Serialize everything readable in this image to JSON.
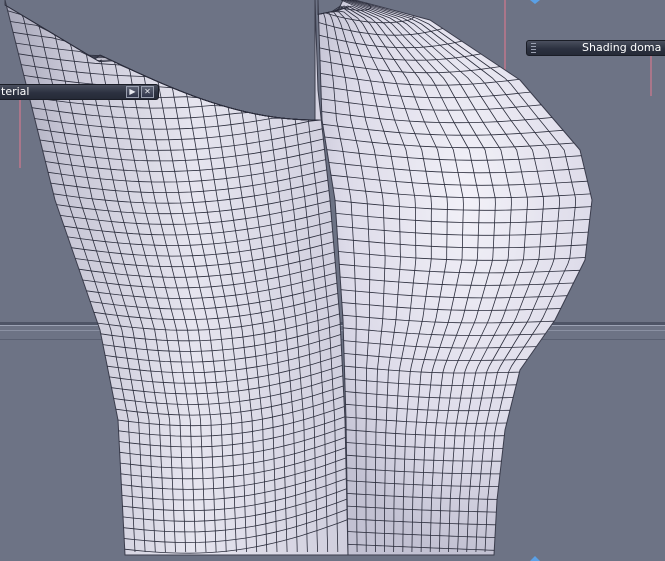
{
  "viewport": {
    "background_color": "#6d7385",
    "mesh_fill_color": "#dedde8",
    "mesh_line_color": "#2b2d3c",
    "guide_line_color": "#e87a8e",
    "edge_marker_color": "#5aa0e6"
  },
  "material_panel": {
    "title": "terial",
    "play_icon": "play-icon",
    "close_icon": "close-icon",
    "play_glyph": "▶",
    "close_glyph": "✕"
  },
  "shading_panel": {
    "title": "Shading doma",
    "grip_icon": "grip-icon"
  }
}
